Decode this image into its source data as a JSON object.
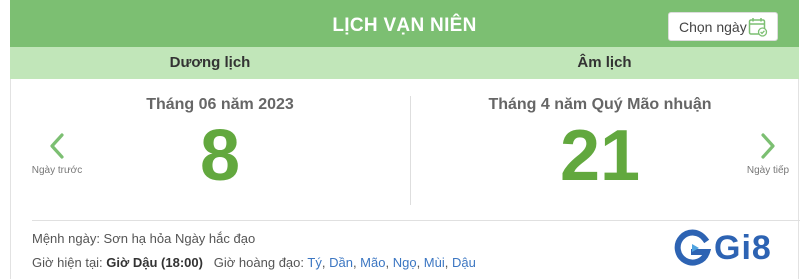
{
  "header": {
    "title": "LỊCH VẠN NIÊN",
    "pick_date_label": "Chọn ngày"
  },
  "columns": {
    "solar_label": "Dương lịch",
    "lunar_label": "Âm lịch"
  },
  "solar": {
    "month_year": "Tháng 06 năm 2023",
    "day": "8"
  },
  "lunar": {
    "month_year": "Tháng 4 năm Quý Mão nhuận",
    "day": "21"
  },
  "nav": {
    "prev_label": "Ngày trước",
    "next_label": "Ngày tiếp"
  },
  "info": {
    "day_fate": "Mệnh ngày: Sơn hạ hỏa Ngày hắc đạo",
    "current_hour_label": "Giờ hiện tại:",
    "current_hour_value": "Giờ Dậu (18:00)",
    "good_hours_label": "Giờ hoàng đạo:",
    "good_hours": [
      "Tý",
      "Dần",
      "Mão",
      "Ngọ",
      "Mùi",
      "Dậu"
    ]
  },
  "logo": {
    "text": "Gi8"
  },
  "colors": {
    "header_green": "#7cbf72",
    "subheader_green": "#c1e6b9",
    "day_green": "#62a83e",
    "link_blue": "#3b76c2",
    "logo_blue": "#2d63b3"
  },
  "icons": {
    "calendar": "calendar-check-icon",
    "prev": "chevron-left-icon",
    "next": "chevron-right-icon"
  }
}
